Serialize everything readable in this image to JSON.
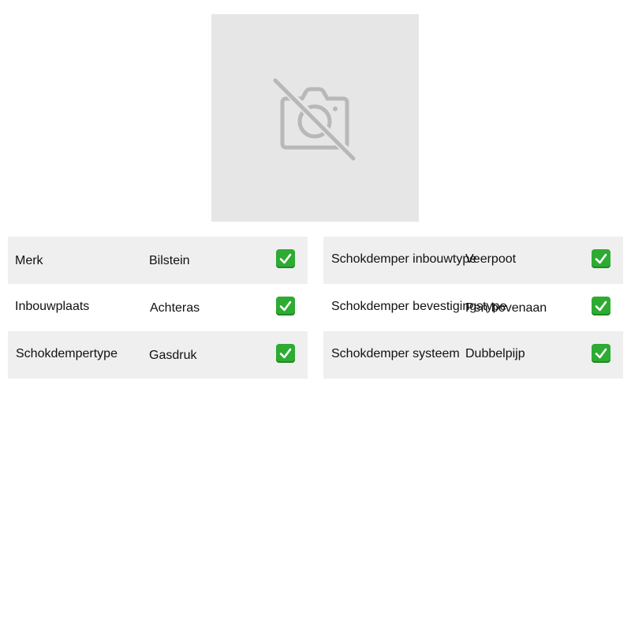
{
  "image": {
    "icon": "camera-off-icon",
    "background_color": "#e6e6e6"
  },
  "specs": {
    "left": [
      {
        "label": "Merk",
        "value": "Bilstein",
        "icon": "checkmark-icon"
      },
      {
        "label": "Inbouwplaats",
        "value": "Achteras",
        "icon": "checkmark-icon"
      },
      {
        "label": "Schokdempertype",
        "value": "Gasdruk",
        "icon": "checkmark-icon"
      }
    ],
    "right": [
      {
        "label": "Schokdemper inbouwtype",
        "value": "Veerpoot",
        "icon": "checkmark-icon"
      },
      {
        "label": "Schokdemper bevestigingstype",
        "value": "Pen bovenaan",
        "icon": "checkmark-icon"
      },
      {
        "label": "Schokdemper systeem",
        "value": "Dubbelpijp",
        "icon": "checkmark-icon"
      }
    ]
  },
  "colors": {
    "row_shaded": "#efefef",
    "check_green": "#2eab32"
  }
}
